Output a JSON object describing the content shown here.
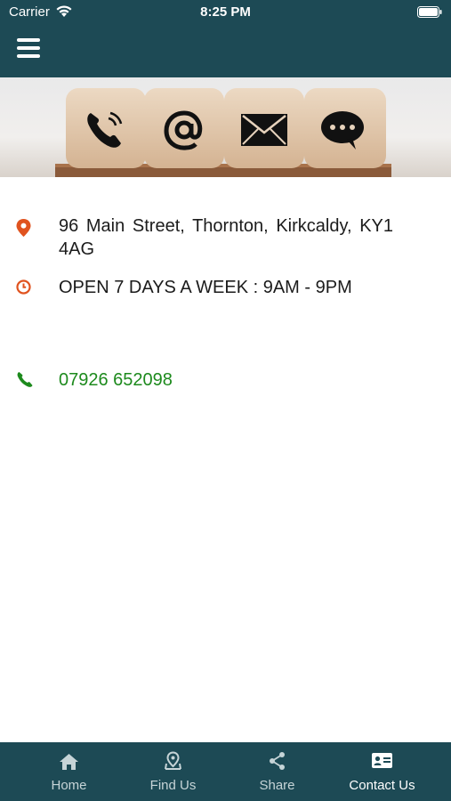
{
  "status_bar": {
    "carrier": "Carrier",
    "time": "8:25 PM"
  },
  "banner": {
    "tiles": [
      "phone-icon",
      "at-sign-icon",
      "envelope-icon",
      "chat-bubble-icon"
    ]
  },
  "contact": {
    "address": "96 Main Street, Thornton, Kirkcaldy, KY1 4AG",
    "hours": "OPEN 7 DAYS A WEEK : 9AM - 9PM",
    "phone": "07926 652098"
  },
  "tabs": [
    {
      "label": "Home",
      "icon": "home-icon"
    },
    {
      "label": "Find Us",
      "icon": "map-pin-icon"
    },
    {
      "label": "Share",
      "icon": "share-icon"
    },
    {
      "label": "Contact Us",
      "icon": "contact-card-icon",
      "active": true
    }
  ],
  "colors": {
    "header": "#1d4a55",
    "icon_accent": "#e0531f",
    "phone_green": "#1d8a1d"
  }
}
